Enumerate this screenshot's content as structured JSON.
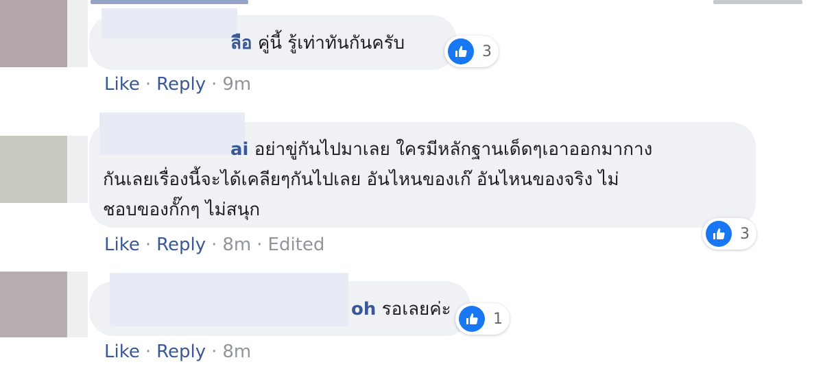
{
  "comments": [
    {
      "author_tail": "ลือ",
      "text": "คู่นี้ รู้เท่าทันกันครับ",
      "reaction_count": "3",
      "actions": {
        "like": "Like",
        "reply": "Reply",
        "time": "9m"
      }
    },
    {
      "author_tail": "ai",
      "text_lines": [
        "อย่าขู่กันไปมาเลย ใครมีหลักฐานเด็ดๆเอาออกมากาง",
        "กันเลยเรื่องนี้จะได้เคลียๆกันไปเลย อันไหนของเก๊ อันไหนของจริง ไม่",
        "ชอบของกั๊กๆ ไม่สนุก"
      ],
      "reaction_count": "3",
      "actions": {
        "like": "Like",
        "reply": "Reply",
        "time": "8m",
        "edited": "Edited"
      }
    },
    {
      "author_tail": "oh",
      "text": "รอเลยค่ะ",
      "reaction_count": "1",
      "actions": {
        "like": "Like",
        "reply": "Reply",
        "time": "8m"
      }
    }
  ],
  "separator": "·",
  "colors": {
    "accent": "#385898",
    "like_blue": "#1877f2",
    "bubble": "#f0f1f4",
    "meta": "#90949c"
  },
  "icons": {
    "reaction": "thumbs-up-icon"
  }
}
